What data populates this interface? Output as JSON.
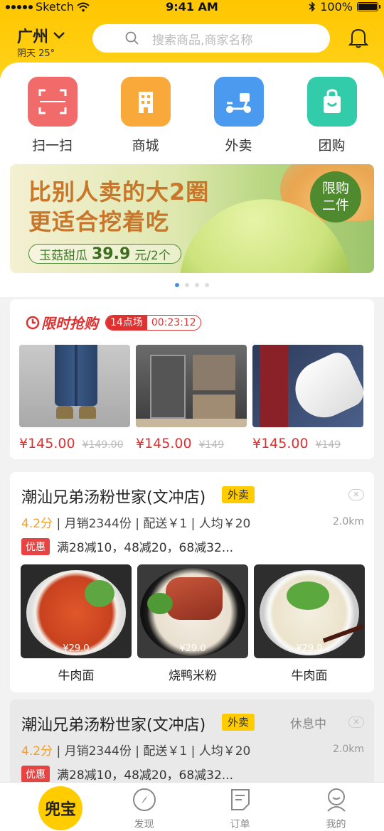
{
  "status": {
    "carrier": "Sketch",
    "time": "9:41 AM",
    "battery": "100%"
  },
  "header": {
    "city": "广州",
    "weather": "阴天 25°",
    "search_placeholder": "搜索商品,商家名称"
  },
  "categories": [
    {
      "label": "扫一扫",
      "icon": "scan-icon",
      "color": "#f26b6b"
    },
    {
      "label": "商城",
      "icon": "building-icon",
      "color": "#f9a83a"
    },
    {
      "label": "外卖",
      "icon": "scooter-icon",
      "color": "#4a9bf0"
    },
    {
      "label": "团购",
      "icon": "shopping-bag-icon",
      "color": "#33ccaa"
    }
  ],
  "banner": {
    "line1": "比别人卖的大2圈",
    "line2": "更适合挖着吃",
    "product": "玉菇甜瓜",
    "price": "39.9",
    "unit": "元/2个",
    "badge": [
      "限购",
      "二件"
    ],
    "page_count": 4,
    "active_page": 1
  },
  "flash_sale": {
    "title": "限时抢购",
    "session": "14点场",
    "countdown": "00:23:12",
    "items": [
      {
        "name": "jeans",
        "price": "¥145.00",
        "old_price": "¥149.00"
      },
      {
        "name": "wardrobe",
        "price": "¥145.00",
        "old_price": "¥149"
      },
      {
        "name": "sneakers",
        "price": "¥145.00",
        "old_price": "¥149"
      }
    ]
  },
  "shops": [
    {
      "name": "潮汕兄弟汤粉世家(文冲店)",
      "tag": "外卖",
      "status": "",
      "score": "4.2分",
      "sales": "| 月销2344份 | 配送￥1 | 人均￥20",
      "distance": "2.0km",
      "promo_badge": "优惠",
      "promo": "满28减10，48减20，68减32...",
      "dishes": [
        {
          "name": "牛肉面",
          "price": "¥29.0"
        },
        {
          "name": "烧鸭米粉",
          "price": "¥29.0"
        },
        {
          "name": "牛肉面",
          "price": "¥29.0"
        }
      ]
    },
    {
      "name": "潮汕兄弟汤粉世家(文冲店)",
      "tag": "外卖",
      "status": "休息中",
      "score": "4.2分",
      "sales": "| 月销2344份 | 配送￥1 | 人均￥20",
      "distance": "2.0km",
      "promo_badge": "优惠",
      "promo": "满28减10，48减20，68减32..."
    }
  ],
  "tabbar": {
    "home": "兜宝",
    "tabs": [
      {
        "label": "发现",
        "icon": "compass-icon"
      },
      {
        "label": "订单",
        "icon": "order-icon"
      },
      {
        "label": "我的",
        "icon": "profile-icon"
      }
    ]
  },
  "colors": {
    "brand_yellow": "#ffc600",
    "sale_red": "#e03030",
    "score_orange": "#f0a030"
  }
}
